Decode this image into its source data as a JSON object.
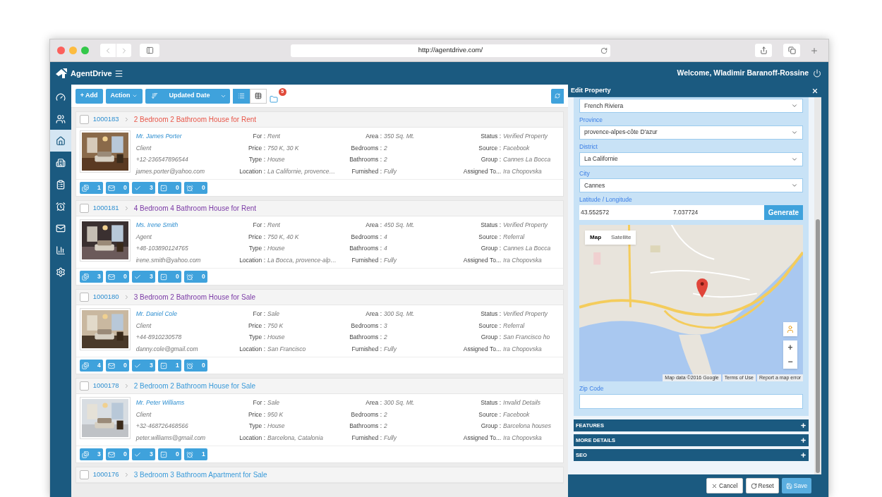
{
  "browser": {
    "url": "http://agentdrive.com/"
  },
  "header": {
    "brand": "AgentDrive",
    "welcome": "Welcome, Wladimir Baranoff-Rossine"
  },
  "sidebar": {
    "items": [
      {
        "selected": false
      },
      {
        "selected": false
      },
      {
        "selected": true
      },
      {
        "selected": false
      },
      {
        "selected": false
      },
      {
        "selected": false
      },
      {
        "selected": false
      },
      {
        "selected": false
      },
      {
        "selected": false
      }
    ]
  },
  "toolbar": {
    "add": "+ Add",
    "action": "Action",
    "sort": "Updated Date",
    "views": [
      {
        "selected": true
      },
      {
        "selected": false
      }
    ],
    "folder_badge": "5"
  },
  "listings": [
    {
      "checked": false,
      "id": "1000183",
      "title": "2 Bedroom 2 Bathroom House for Rent",
      "color": "#e8574a",
      "contact": {
        "name": "Mr. James Porter",
        "role": "Client",
        "phone": "+12-236547896544",
        "email": "james.porter@yahoo.com"
      },
      "columns": [
        [
          {
            "label": "For :",
            "value": "Rent"
          },
          {
            "label": "Price :",
            "value": "750 K, 30 K"
          },
          {
            "label": "Type :",
            "value": "House"
          },
          {
            "label": "Location :",
            "value": "La Californie, provence…"
          }
        ],
        [
          {
            "label": "Area :",
            "value": "350 Sq. Mt."
          },
          {
            "label": "Bedrooms :",
            "value": "2"
          },
          {
            "label": "Bathrooms :",
            "value": "2"
          },
          {
            "label": "Furnished :",
            "value": "Fully"
          }
        ],
        [
          {
            "label": "Status :",
            "value": "Verified Property"
          },
          {
            "label": "Source :",
            "value": "Facebook"
          },
          {
            "label": "Group :",
            "value": "Cannes La Bocca"
          },
          {
            "label": "Assigned To...",
            "value": "Ira Chopovska"
          }
        ]
      ],
      "counters": [
        "1",
        "0",
        "3",
        "0",
        "0"
      ]
    },
    {
      "checked": false,
      "id": "1000181",
      "title": "4 Bedroom 4 Bathroom House for Rent",
      "color": "#7b3aa6",
      "contact": {
        "name": "Ms. Irene Smith",
        "role": "Agent",
        "phone": "+48-103890124765",
        "email": "irene.smith@yahoo.com"
      },
      "columns": [
        [
          {
            "label": "For :",
            "value": "Rent"
          },
          {
            "label": "Price :",
            "value": "750 K, 40 K"
          },
          {
            "label": "Type :",
            "value": "House"
          },
          {
            "label": "Location :",
            "value": "La Bocca, provence-alp…"
          }
        ],
        [
          {
            "label": "Area :",
            "value": "450 Sq. Mt."
          },
          {
            "label": "Bedrooms :",
            "value": "4"
          },
          {
            "label": "Bathrooms :",
            "value": "4"
          },
          {
            "label": "Furnished :",
            "value": "Fully"
          }
        ],
        [
          {
            "label": "Status :",
            "value": "Verified Property"
          },
          {
            "label": "Source :",
            "value": "Referral"
          },
          {
            "label": "Group :",
            "value": "Cannes La Bocca"
          },
          {
            "label": "Assigned To...",
            "value": "Ira Chopovska"
          }
        ]
      ],
      "counters": [
        "3",
        "0",
        "3",
        "0",
        "0"
      ]
    },
    {
      "checked": false,
      "id": "1000180",
      "title": "3 Bedroom 2 Bathroom House for Sale",
      "color": "#7b3aa6",
      "contact": {
        "name": "Mr. Daniel Cole",
        "role": "Client",
        "phone": "+44-8910230578",
        "email": "danny.cole@gmail.com"
      },
      "columns": [
        [
          {
            "label": "For :",
            "value": "Sale"
          },
          {
            "label": "Price :",
            "value": "750 K"
          },
          {
            "label": "Type :",
            "value": "House"
          },
          {
            "label": "Location :",
            "value": "San Francisco"
          }
        ],
        [
          {
            "label": "Area :",
            "value": "300 Sq. Mt."
          },
          {
            "label": "Bedrooms :",
            "value": "3"
          },
          {
            "label": "Bathrooms :",
            "value": "2"
          },
          {
            "label": "Furnished :",
            "value": "Fully"
          }
        ],
        [
          {
            "label": "Status :",
            "value": "Verified Property"
          },
          {
            "label": "Source :",
            "value": "Referral"
          },
          {
            "label": "Group :",
            "value": "San Francisco ho"
          },
          {
            "label": "Assigned To...",
            "value": "Ira Chopovska"
          }
        ]
      ],
      "counters": [
        "4",
        "0",
        "3",
        "1",
        "0"
      ]
    },
    {
      "checked": false,
      "id": "1000178",
      "title": "2 Bedroom 2 Bathroom House for Sale",
      "color": "#3a9ad9",
      "contact": {
        "name": "Mr. Peter Williams",
        "role": "Client",
        "phone": "+32-468726468566",
        "email": "peter.williams@gmail.com"
      },
      "columns": [
        [
          {
            "label": "For :",
            "value": "Sale"
          },
          {
            "label": "Price :",
            "value": "950 K"
          },
          {
            "label": "Type :",
            "value": "House"
          },
          {
            "label": "Location :",
            "value": "Barcelona, Catalonia"
          }
        ],
        [
          {
            "label": "Area :",
            "value": "300 Sq. Mt."
          },
          {
            "label": "Bedrooms :",
            "value": "2"
          },
          {
            "label": "Bathrooms :",
            "value": "2"
          },
          {
            "label": "Furnished :",
            "value": "Fully"
          }
        ],
        [
          {
            "label": "Status :",
            "value": "Invalid Details"
          },
          {
            "label": "Source :",
            "value": "Facebook"
          },
          {
            "label": "Group :",
            "value": "Barcelona houses"
          },
          {
            "label": "Assigned To...",
            "value": "Ira Chopovska"
          }
        ]
      ],
      "counters": [
        "3",
        "0",
        "3",
        "0",
        "1"
      ]
    },
    {
      "checked": false,
      "id": "1000176",
      "title": "3 Bedroom 3 Bathroom Apartment for Sale",
      "color": "#3a9ad9"
    }
  ],
  "panel": {
    "title": "Edit Property",
    "fields": [
      {
        "kind": "select",
        "value": "French Riviera"
      },
      {
        "kind": "select",
        "label": "Province",
        "value": "provence-alpes-côte D'azur"
      },
      {
        "kind": "select",
        "label": "District",
        "value": "La Californie"
      },
      {
        "kind": "select",
        "label": "City",
        "value": "Cannes"
      },
      {
        "kind": "coords",
        "label": "Latitude / Longitude",
        "values": [
          "43.552572",
          "7.037724"
        ],
        "button": "Generate"
      },
      {
        "kind": "map",
        "types": [
          {
            "label": "Map",
            "selected": true
          },
          {
            "label": "Satellite",
            "selected": false
          }
        ],
        "zoom": [
          "+",
          "−"
        ],
        "attribution": [
          "Map data ©2016 Google",
          "Terms of Use",
          "Report a map error"
        ]
      },
      {
        "kind": "text",
        "label": "Zip Code"
      }
    ],
    "sections": [
      {
        "label": "FEATURES",
        "expanded": false
      },
      {
        "label": "MORE DETAILS",
        "expanded": false
      },
      {
        "label": "SEO",
        "expanded": false
      }
    ],
    "buttons": [
      {
        "kind": "cancel",
        "label": "Cancel"
      },
      {
        "kind": "reset",
        "label": "Reset"
      },
      {
        "kind": "save",
        "label": "Save"
      }
    ]
  }
}
